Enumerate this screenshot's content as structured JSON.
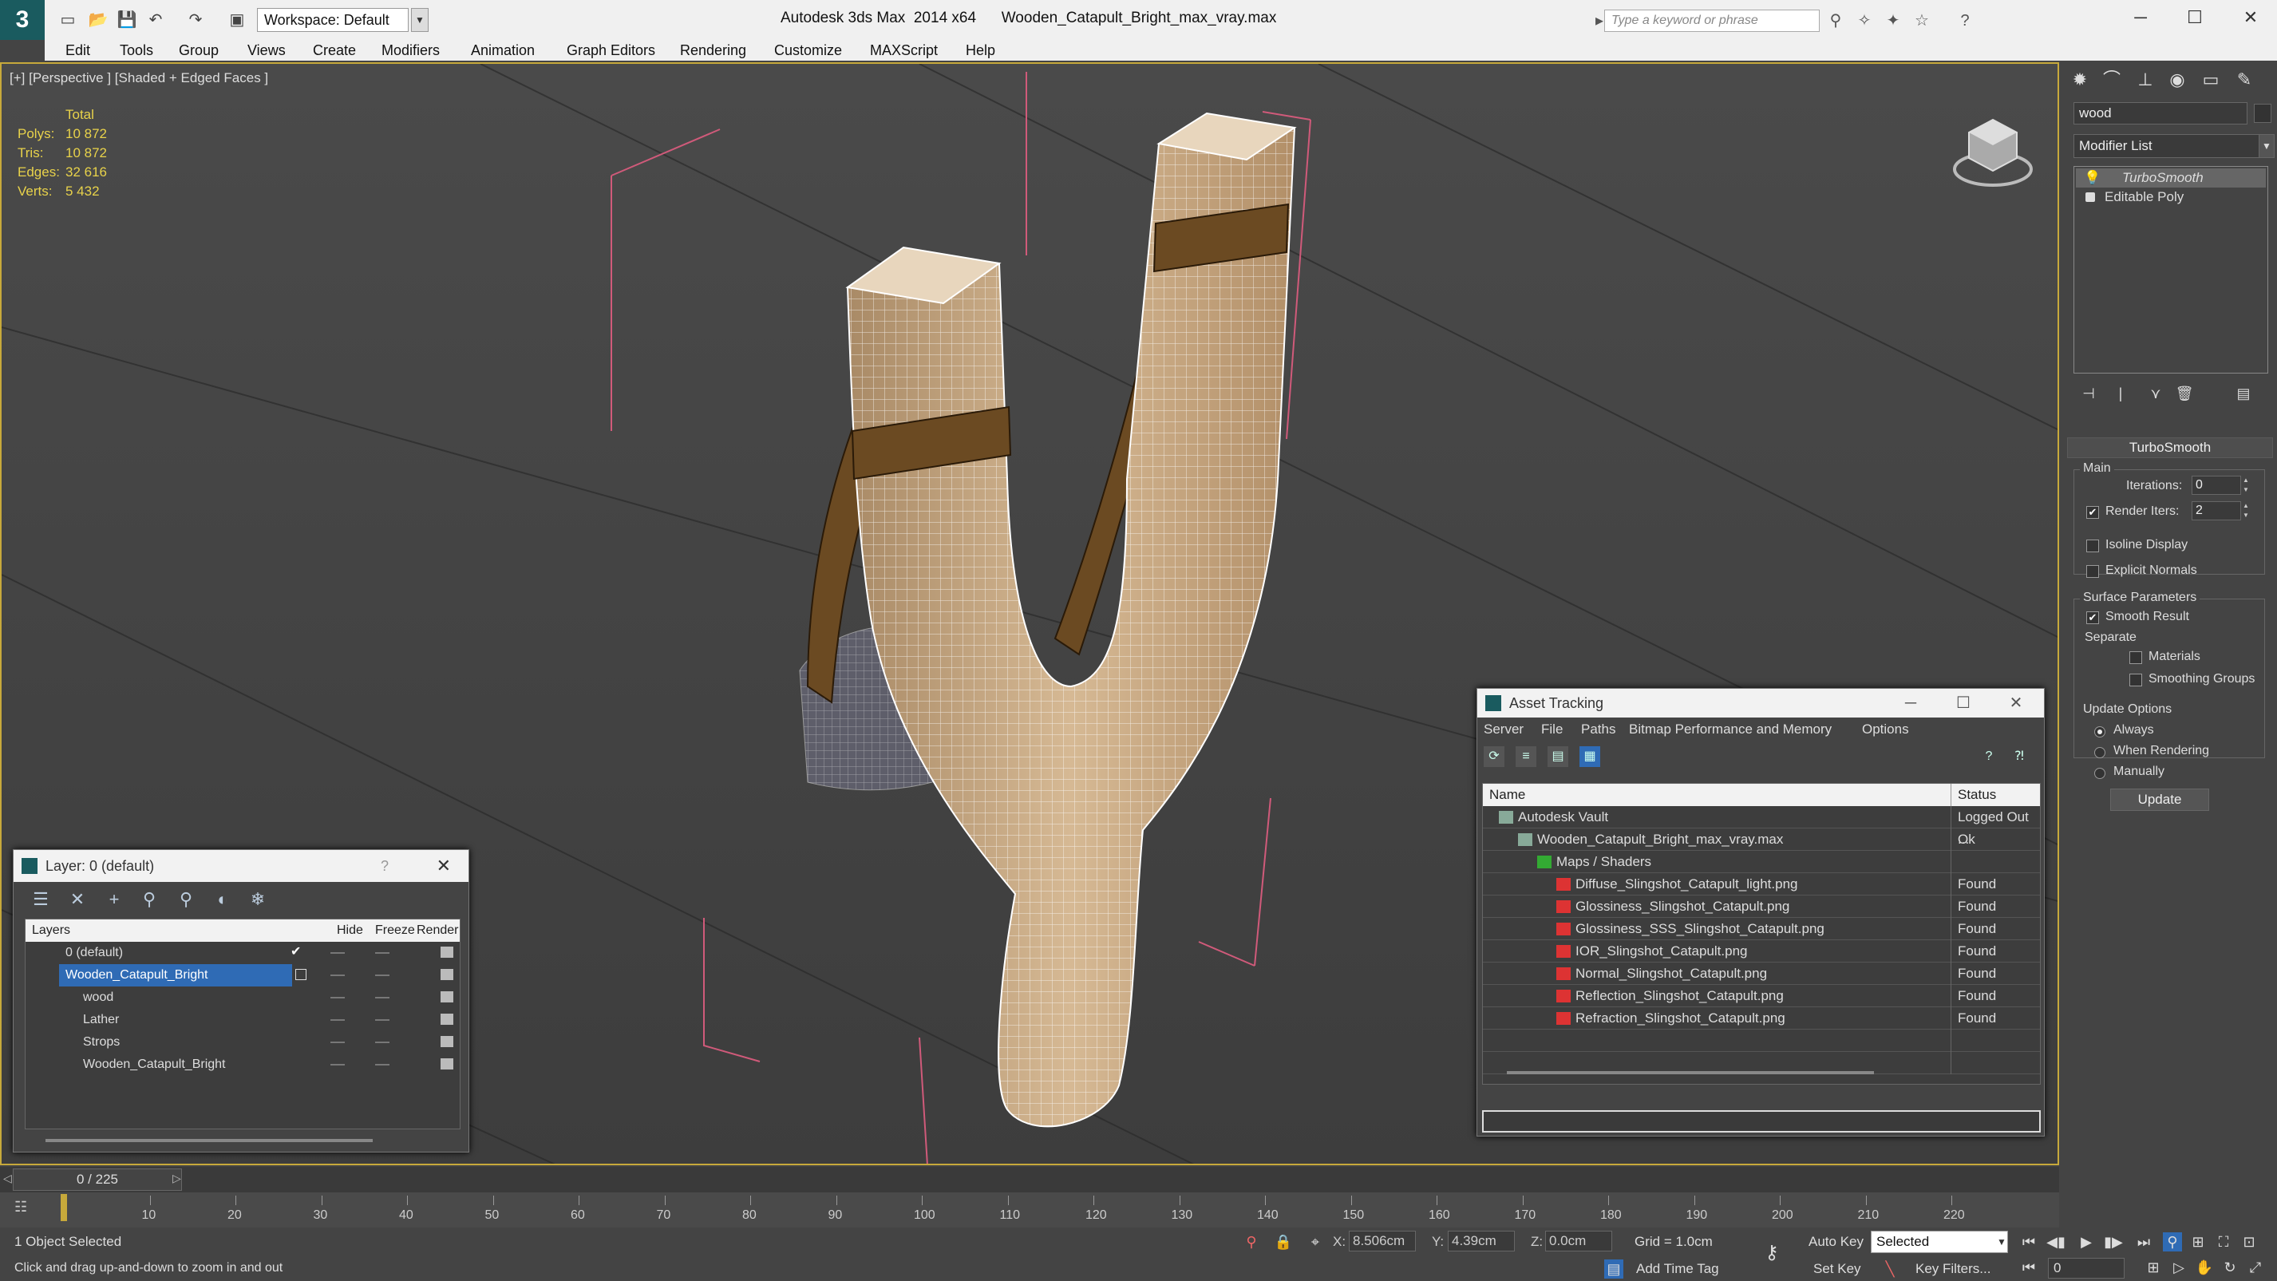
{
  "app": {
    "title": "Autodesk 3ds Max  2014 x64      Wooden_Catapult_Bright_max_vray.max",
    "workspace": "Workspace: Default",
    "search_placeholder": "Type a keyword or phrase",
    "logo_glyph": "3"
  },
  "menubar": [
    "Edit",
    "Tools",
    "Group",
    "Views",
    "Create",
    "Modifiers",
    "Animation",
    "Graph Editors",
    "Rendering",
    "Customize",
    "MAXScript",
    "Help"
  ],
  "viewport": {
    "label": "[+] [Perspective ] [Shaded + Edged Faces ]",
    "stats": {
      "header": "Total",
      "rows": [
        {
          "label": "Polys:",
          "value": "10 872"
        },
        {
          "label": "Tris:",
          "value": "10 872"
        },
        {
          "label": "Edges:",
          "value": "32 616"
        },
        {
          "label": "Verts:",
          "value": "5 432"
        }
      ]
    }
  },
  "layer_panel": {
    "title": "Layer: 0 (default)",
    "help": "?",
    "headers": {
      "layers": "Layers",
      "hide": "Hide",
      "freeze": "Freeze",
      "render": "Render"
    },
    "rows": [
      {
        "name": "0 (default)",
        "level": 0,
        "current": true,
        "selected": false
      },
      {
        "name": "Wooden_Catapult_Bright",
        "level": 0,
        "current": false,
        "selected": true
      },
      {
        "name": "wood",
        "level": 1,
        "current": false,
        "selected": false
      },
      {
        "name": "Lather",
        "level": 1,
        "current": false,
        "selected": false
      },
      {
        "name": "Strops",
        "level": 1,
        "current": false,
        "selected": false
      },
      {
        "name": "Wooden_Catapult_Bright",
        "level": 1,
        "current": false,
        "selected": false
      }
    ]
  },
  "asset_tracking": {
    "title": "Asset Tracking",
    "menu": [
      "Server",
      "File",
      "Paths",
      "Bitmap Performance and Memory",
      "Options"
    ],
    "headers": {
      "name": "Name",
      "status": "Status"
    },
    "rows": [
      {
        "name": "Autodesk Vault",
        "status": "Logged Out ...",
        "level": 1,
        "icon": "vault-icon"
      },
      {
        "name": "Wooden_Catapult_Bright_max_vray.max",
        "status": "Ok",
        "level": 2,
        "icon": "max-file-icon"
      },
      {
        "name": "Maps / Shaders",
        "status": "",
        "level": 3,
        "icon": "maps-icon"
      },
      {
        "name": "Diffuse_Slingshot_Catapult_light.png",
        "status": "Found",
        "level": 4,
        "icon": "png-icon"
      },
      {
        "name": "Glossiness_Slingshot_Catapult.png",
        "status": "Found",
        "level": 4,
        "icon": "png-icon"
      },
      {
        "name": "Glossiness_SSS_Slingshot_Catapult.png",
        "status": "Found",
        "level": 4,
        "icon": "png-icon"
      },
      {
        "name": "IOR_Slingshot_Catapult.png",
        "status": "Found",
        "level": 4,
        "icon": "png-icon"
      },
      {
        "name": "Normal_Slingshot_Catapult.png",
        "status": "Found",
        "level": 4,
        "icon": "png-icon"
      },
      {
        "name": "Reflection_Slingshot_Catapult.png",
        "status": "Found",
        "level": 4,
        "icon": "png-icon"
      },
      {
        "name": "Refraction_Slingshot_Catapult.png",
        "status": "Found",
        "level": 4,
        "icon": "png-icon"
      }
    ]
  },
  "command_panel": {
    "object_name": "wood",
    "modifier_list": "Modifier List",
    "stack": [
      {
        "name": "TurboSmooth",
        "active": true
      },
      {
        "name": "Editable Poly",
        "active": false
      }
    ],
    "rollout_title": "TurboSmooth",
    "main_label": "Main",
    "iterations_label": "Iterations:",
    "iterations_value": "0",
    "render_iters_label": "Render Iters:",
    "render_iters_value": "2",
    "render_iters_checked": true,
    "isoline_label": "Isoline Display",
    "explicit_normals_label": "Explicit Normals",
    "surface_params_label": "Surface Parameters",
    "smooth_result_label": "Smooth Result",
    "separate_label": "Separate",
    "materials_label": "Materials",
    "smoothing_groups_label": "Smoothing Groups",
    "update_options_label": "Update Options",
    "update_always": "Always",
    "update_when_rendering": "When Rendering",
    "update_manually": "Manually",
    "update_button": "Update"
  },
  "timeline": {
    "frame_display": "0 / 225",
    "ticks": [
      "10",
      "20",
      "30",
      "40",
      "50",
      "60",
      "70",
      "80",
      "90",
      "100",
      "110",
      "120",
      "130",
      "140",
      "150",
      "160",
      "170",
      "180",
      "190",
      "200",
      "210",
      "220"
    ]
  },
  "statusbar": {
    "selection": "1 Object Selected",
    "prompt": "Click and drag up-and-down to zoom in and out",
    "x_label": "X:",
    "x_value": "8.506cm",
    "y_label": "Y:",
    "y_value": "4.39cm",
    "z_label": "Z:",
    "z_value": "0.0cm",
    "grid": "Grid = 1.0cm",
    "add_time_tag": "Add Time Tag",
    "auto_key": "Auto Key",
    "set_key": "Set Key",
    "selection_set": "Selected",
    "key_filters": "Key Filters...",
    "current_frame": "0"
  },
  "colors": {
    "accent": "#c7a93b",
    "selection_blue": "#2f6bb5",
    "wireframe": "#ffffff",
    "grid": "#d05a7a",
    "wood": "#c9a880",
    "leather": "#6b4a22"
  }
}
